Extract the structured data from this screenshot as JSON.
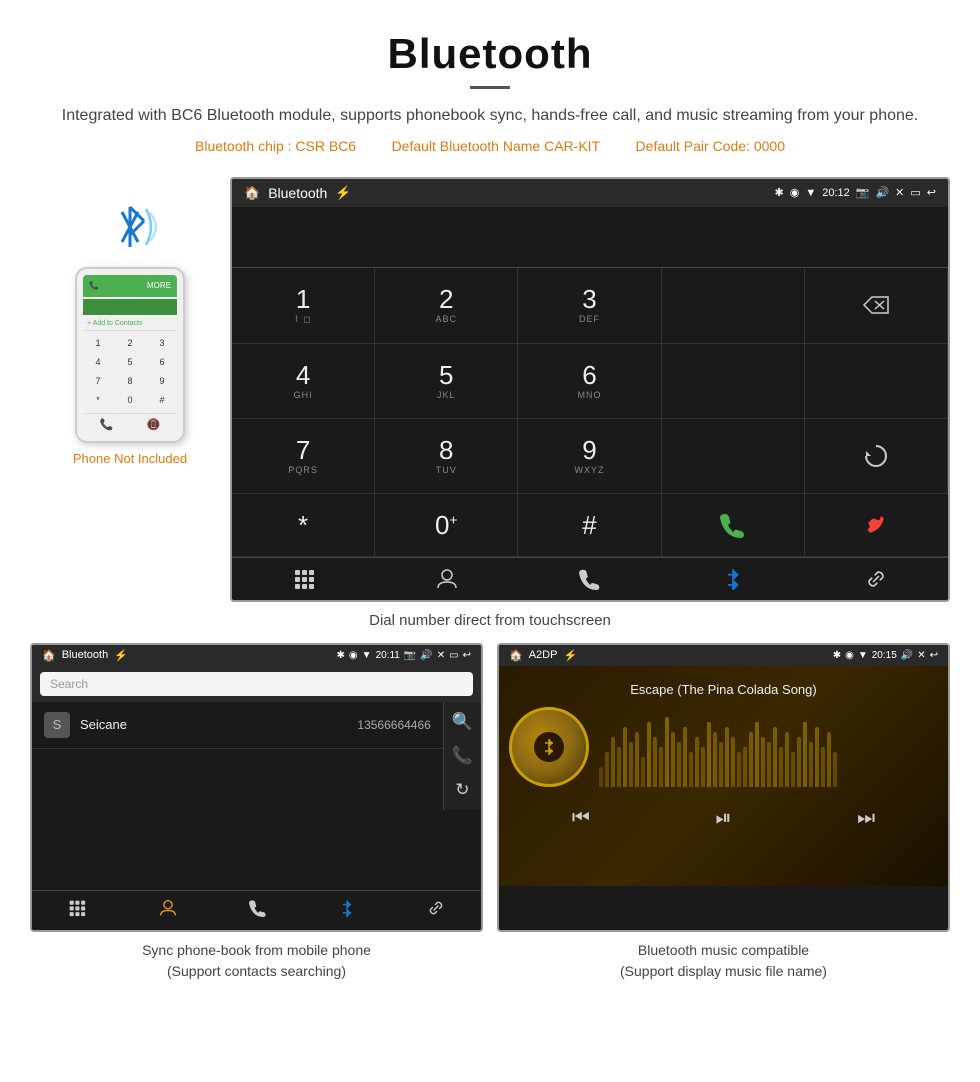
{
  "header": {
    "title": "Bluetooth",
    "description": "Integrated with BC6 Bluetooth module, supports phonebook sync, hands-free call, and music streaming from your phone.",
    "specs": {
      "chip": "Bluetooth chip : CSR BC6",
      "name": "Default Bluetooth Name CAR-KIT",
      "code": "Default Pair Code: 0000"
    }
  },
  "phone_label": "Phone Not Included",
  "dialer_screen": {
    "title": "Bluetooth",
    "time": "20:12",
    "keys": [
      {
        "num": "1",
        "sub": ""
      },
      {
        "num": "2",
        "sub": "ABC"
      },
      {
        "num": "3",
        "sub": "DEF"
      },
      {
        "num": "*",
        "sub": ""
      },
      {
        "num": "0",
        "sub": "+"
      },
      {
        "num": "#",
        "sub": ""
      },
      {
        "num": "4",
        "sub": "GHI"
      },
      {
        "num": "5",
        "sub": "JKL"
      },
      {
        "num": "6",
        "sub": "MNO"
      },
      {
        "num": "7",
        "sub": "PQRS"
      },
      {
        "num": "8",
        "sub": "TUV"
      },
      {
        "num": "9",
        "sub": "WXYZ"
      }
    ]
  },
  "dialer_caption": "Dial number direct from touchscreen",
  "phonebook_screen": {
    "title": "Bluetooth",
    "time": "20:11",
    "search_placeholder": "Search",
    "contact": {
      "initial": "S",
      "name": "Seicane",
      "number": "13566664466"
    }
  },
  "phonebook_caption": "Sync phone-book from mobile phone\n(Support contacts searching)",
  "music_screen": {
    "title": "A2DP",
    "time": "20:15",
    "song": "Escape (The Pina Colada Song)"
  },
  "music_caption": "Bluetooth music compatible\n(Support display music file name)"
}
